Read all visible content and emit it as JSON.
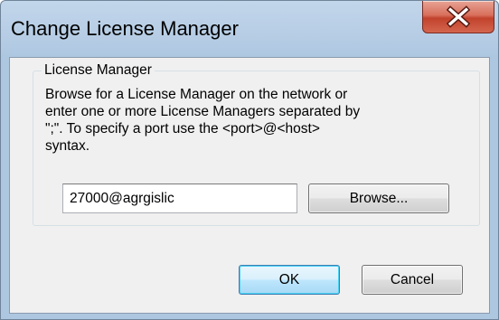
{
  "window": {
    "title": "Change License Manager",
    "close_glyph": "X"
  },
  "group": {
    "legend": "License Manager",
    "description": "Browse for a License Manager on the network or\nenter one or more License Managers separated by\n\";\".  To specify a port use the <port>@<host>\nsyntax."
  },
  "license_manager_input": {
    "value": "27000@agrgislic"
  },
  "buttons": {
    "browse": "Browse...",
    "ok": "OK",
    "cancel": "Cancel"
  },
  "colors": {
    "frame": "#b9cfe6",
    "client": "#f0f0f0",
    "close_button": "#c2422c",
    "ok_focus_border": "#3c7fb1"
  },
  "icons": {
    "close": "close-icon"
  }
}
